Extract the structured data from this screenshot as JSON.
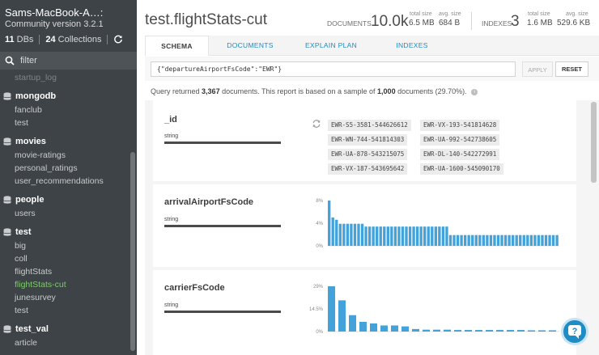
{
  "sidebar": {
    "host": "Sams-MacBook-A…:",
    "version": "Community version 3.2.1",
    "db_count": "11",
    "db_label": "DBs",
    "coll_count": "24",
    "coll_label": "Collections",
    "filter_placeholder": "filter",
    "top_item": "startup_log",
    "databases": [
      {
        "name": "mongodb",
        "collections": [
          "fanclub",
          "test"
        ]
      },
      {
        "name": "movies",
        "collections": [
          "movie-ratings",
          "personal_ratings",
          "user_recommendations"
        ]
      },
      {
        "name": "people",
        "collections": [
          "users"
        ]
      },
      {
        "name": "test",
        "collections": [
          "big",
          "coll",
          "flightStats",
          "flightStats-cut",
          "junesurvey",
          "test"
        ]
      },
      {
        "name": "test_val",
        "collections": [
          "article"
        ]
      }
    ],
    "active_collection": "flightStats-cut"
  },
  "header": {
    "title": "test.flightStats-cut",
    "documents_label": "DOCUMENTS",
    "documents_count": "10.0k",
    "total_size_label": "total size",
    "documents_total_size": "6.5 MB",
    "avg_size_label": "avg. size",
    "documents_avg_size": "684 B",
    "indexes_label": "INDEXES",
    "indexes_count": "3",
    "indexes_total_size": "1.6 MB",
    "indexes_avg_size": "529.6 KB"
  },
  "tabs": [
    {
      "label": "SCHEMA",
      "active": true
    },
    {
      "label": "DOCUMENTS",
      "active": false
    },
    {
      "label": "EXPLAIN PLAN",
      "active": false
    },
    {
      "label": "INDEXES",
      "active": false
    }
  ],
  "query": {
    "value": "{\"departureAirportFsCode\":\"EWR\"}",
    "apply_label": "APPLY",
    "reset_label": "RESET"
  },
  "query_info": {
    "prefix": "Query returned",
    "returned": "3,367",
    "middle": "documents. This report is based on a sample of",
    "sample": "1,000",
    "suffix": "documents (29.70%)."
  },
  "fields": [
    {
      "name": "_id",
      "type": "string",
      "values": [
        "EWR-S5-3581-544626612",
        "EWR-VX-193-541814628",
        "EWR-WN-744-541814303",
        "EWR-UA-992-542738605",
        "EWR-UA-878-543215075",
        "EWR-DL-140-542272991",
        "EWR-VX-187-543695642",
        "EWR-UA-1600-545090170"
      ]
    },
    {
      "name": "arrivalAirportFsCode",
      "type": "string"
    },
    {
      "name": "carrierFsCode",
      "type": "string"
    }
  ],
  "chart_data": [
    {
      "type": "bar",
      "field": "arrivalAirportFsCode",
      "yticks": [
        "8%",
        "4%",
        "0%"
      ],
      "ylim": [
        0,
        8
      ],
      "values": [
        8.0,
        5.0,
        4.6,
        3.9,
        3.9,
        3.9,
        3.9,
        3.9,
        3.9,
        3.9,
        3.4,
        3.4,
        3.4,
        3.4,
        3.4,
        3.4,
        3.4,
        3.4,
        3.4,
        3.4,
        3.4,
        3.4,
        3.4,
        3.4,
        3.4,
        3.4,
        3.4,
        3.4,
        3.4,
        3.4,
        3.4,
        3.4,
        3.4,
        1.9,
        1.9,
        1.9,
        1.9,
        1.9,
        1.9,
        1.9,
        1.9,
        1.9,
        1.9,
        1.9,
        1.9,
        1.9,
        1.9,
        1.9,
        1.9,
        1.9,
        1.9,
        1.9,
        1.9,
        1.9,
        1.9,
        1.9,
        1.9,
        1.9,
        1.9,
        1.9,
        1.9,
        1.9,
        1.9
      ]
    },
    {
      "type": "bar",
      "field": "carrierFsCode",
      "yticks": [
        "29%",
        "14.5%",
        "0%"
      ],
      "ylim": [
        0,
        29
      ],
      "values": [
        29.0,
        20.0,
        10.5,
        6.2,
        5.2,
        3.9,
        3.9,
        3.3,
        1.6,
        1.2,
        1.2,
        1.2,
        1.0,
        1.0,
        1.0,
        1.0,
        1.0,
        1.0,
        1.0,
        0.8,
        0.8,
        0.8
      ]
    }
  ],
  "colors": {
    "bar": "#42a2d9",
    "accent": "#1e8cc5",
    "active_collection": "#7ecb6e"
  }
}
